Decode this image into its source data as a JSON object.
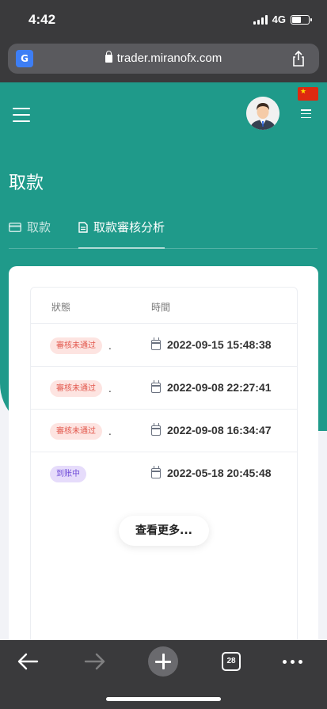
{
  "status_bar": {
    "time": "4:42",
    "network": "4G"
  },
  "browser": {
    "url": "trader.miranofx.com",
    "tab_count": "28",
    "translate_icon": "translate-icon"
  },
  "page": {
    "title": "取款"
  },
  "tabs": [
    {
      "label": "取款",
      "icon": "credit-card-icon",
      "active": false
    },
    {
      "label": "取款審核分析",
      "icon": "document-icon",
      "active": true
    }
  ],
  "table": {
    "headers": {
      "status": "狀態",
      "time": "時間"
    },
    "rows": [
      {
        "status": "審核未通过",
        "suffix": ".",
        "time": "2022-09-15 15:48:38",
        "status_color": "#e2574c"
      },
      {
        "status": "審核未通过",
        "suffix": ".",
        "time": "2022-09-08 22:27:41",
        "status_color": "#e2574c"
      },
      {
        "status": "審核未通过",
        "suffix": ".",
        "time": "2022-09-08 16:34:47",
        "status_color": "#e2574c"
      },
      {
        "status": "到账中",
        "suffix": "",
        "time": "2022-05-18 20:45:48",
        "status_color": "#6f4bd8"
      }
    ]
  },
  "load_more": {
    "label": "查看更多..."
  },
  "colors": {
    "primary": "#1f9a8a",
    "chrome": "#3a3a3c"
  }
}
